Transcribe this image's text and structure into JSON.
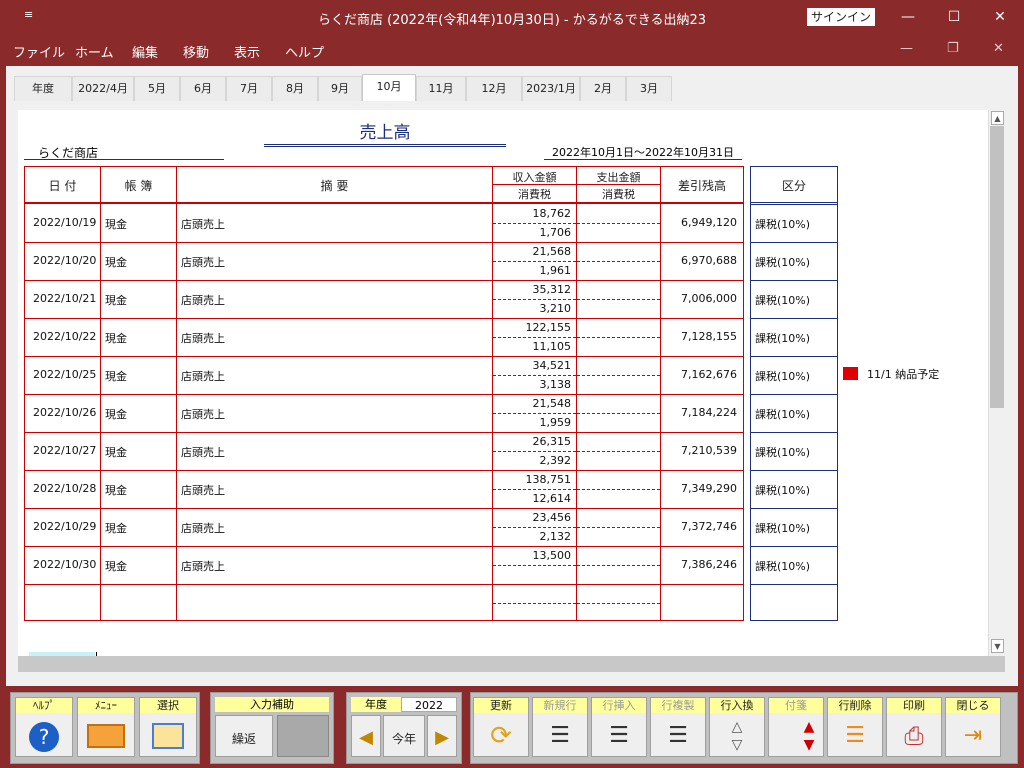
{
  "window": {
    "title": "らくだ商店 (2022年(令和4年)10月30日) - かるがるできる出納23",
    "sysmenu": "≡",
    "signin": "サインイン"
  },
  "menu": [
    "ファイル",
    "ホーム",
    "編集",
    "移動",
    "表示",
    "ヘルプ"
  ],
  "tabs": [
    "年度",
    "2022/4月",
    "5月",
    "6月",
    "7月",
    "8月",
    "9月",
    "10月",
    "11月",
    "12月",
    "2023/1月",
    "2月",
    "3月"
  ],
  "active_tab": "10月",
  "report": {
    "title": "売上高",
    "company": "らくだ商店",
    "period": "2022年10月1日～2022年10月31日",
    "headers": {
      "date": "日 付",
      "book": "帳 簿",
      "desc": "摘 要",
      "income": "収入金額",
      "tax1": "消費税",
      "expense": "支出金額",
      "tax2": "消費税",
      "balance": "差引残高",
      "kubun": "区分"
    }
  },
  "rows": [
    {
      "date": "2022/10/19",
      "book": "現金",
      "desc": "店頭売上",
      "income": "18,762",
      "tax": "1,706",
      "balance": "6,949,120",
      "kubun": "課税(10%)"
    },
    {
      "date": "2022/10/20",
      "book": "現金",
      "desc": "店頭売上",
      "income": "21,568",
      "tax": "1,961",
      "balance": "6,970,688",
      "kubun": "課税(10%)"
    },
    {
      "date": "2022/10/21",
      "book": "現金",
      "desc": "店頭売上",
      "income": "35,312",
      "tax": "3,210",
      "balance": "7,006,000",
      "kubun": "課税(10%)"
    },
    {
      "date": "2022/10/22",
      "book": "現金",
      "desc": "店頭売上",
      "income": "122,155",
      "tax": "11,105",
      "balance": "7,128,155",
      "kubun": "課税(10%)"
    },
    {
      "date": "2022/10/25",
      "book": "現金",
      "desc": "店頭売上",
      "income": "34,521",
      "tax": "3,138",
      "balance": "7,162,676",
      "kubun": "課税(10%)"
    },
    {
      "date": "2022/10/26",
      "book": "現金",
      "desc": "店頭売上",
      "income": "21,548",
      "tax": "1,959",
      "balance": "7,184,224",
      "kubun": "課税(10%)"
    },
    {
      "date": "2022/10/27",
      "book": "現金",
      "desc": "店頭売上",
      "income": "26,315",
      "tax": "2,392",
      "balance": "7,210,539",
      "kubun": "課税(10%)"
    },
    {
      "date": "2022/10/28",
      "book": "現金",
      "desc": "店頭売上",
      "income": "138,751",
      "tax": "12,614",
      "balance": "7,349,290",
      "kubun": "課税(10%)"
    },
    {
      "date": "2022/10/29",
      "book": "現金",
      "desc": "店頭売上",
      "income": "23,456",
      "tax": "2,132",
      "balance": "7,372,746",
      "kubun": "課税(10%)"
    },
    {
      "date": "2022/10/30",
      "book": "現金",
      "desc": "店頭売上",
      "income": "13,500",
      "tax": "",
      "balance": "7,386,246",
      "kubun": "課税(10%)"
    }
  ],
  "note": {
    "text": "11/1 納品予定",
    "color": "#e00000"
  },
  "toolbar": {
    "help": "ﾍﾙﾌﾟ",
    "menu": "ﾒﾆｭｰ",
    "select": "選択",
    "input_assist": "入力補助",
    "repeat": "繰返",
    "year_label": "年度",
    "year_value": "2022",
    "this_year": "今年",
    "refresh": "更新",
    "new_row": "新規行",
    "insert_row": "行挿入",
    "copy_row": "行複製",
    "swap_row": "行入換",
    "tag": "付箋",
    "delete_row": "行削除",
    "print": "印刷",
    "close": "閉じる"
  }
}
